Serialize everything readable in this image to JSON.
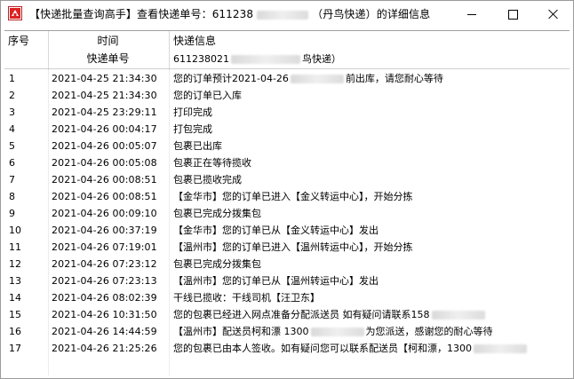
{
  "window": {
    "title_prefix": "【快递批量查询高手】查看快递单号：611238",
    "title_suffix": "（丹鸟快递）的详细信息"
  },
  "columns": {
    "no": "序号",
    "time": "时间",
    "info": "快递信息"
  },
  "subheader": {
    "time": "快递单号",
    "info_prefix": "611238021",
    "info_suffix": "鸟快递）"
  },
  "rows": [
    {
      "no": "1",
      "time": "2021-04-25 21:34:30",
      "info": "您的订单预计2021-04-26",
      "info_tail": "前出库，请您耐心等待"
    },
    {
      "no": "2",
      "time": "2021-04-25 21:34:30",
      "info": "您的订单已入库",
      "info_tail": ""
    },
    {
      "no": "3",
      "time": "2021-04-25 23:29:11",
      "info": "打印完成",
      "info_tail": ""
    },
    {
      "no": "4",
      "time": "2021-04-26 00:04:17",
      "info": "打包完成",
      "info_tail": ""
    },
    {
      "no": "5",
      "time": "2021-04-26 00:05:07",
      "info": "包裹已出库",
      "info_tail": ""
    },
    {
      "no": "6",
      "time": "2021-04-26 00:05:08",
      "info": "包裹正在等待揽收",
      "info_tail": ""
    },
    {
      "no": "7",
      "time": "2021-04-26 00:08:51",
      "info": "包裹已揽收完成",
      "info_tail": ""
    },
    {
      "no": "8",
      "time": "2021-04-26 00:08:51",
      "info": "【金华市】您的订单已进入【金义转运中心】，开始分拣",
      "info_tail": ""
    },
    {
      "no": "9",
      "time": "2021-04-26 00:09:10",
      "info": "包裹已完成分拨集包",
      "info_tail": ""
    },
    {
      "no": "10",
      "time": "2021-04-26 00:37:19",
      "info": "【金华市】您的订单已从【金义转运中心】发出",
      "info_tail": ""
    },
    {
      "no": "11",
      "time": "2021-04-26 07:19:01",
      "info": "【温州市】您的订单已进入【温州转运中心】，开始分拣",
      "info_tail": ""
    },
    {
      "no": "12",
      "time": "2021-04-26 07:23:12",
      "info": "包裹已完成分拨集包",
      "info_tail": ""
    },
    {
      "no": "13",
      "time": "2021-04-26 07:23:13",
      "info": "【温州市】您的订单已从【温州转运中心】发出",
      "info_tail": ""
    },
    {
      "no": "14",
      "time": "2021-04-26 08:02:39",
      "info": "干线已揽收：干线司机【汪卫东】",
      "info_tail": ""
    },
    {
      "no": "15",
      "time": "2021-04-26 10:31:50",
      "info": "您的包裹已经进入网点准备分配派送员 如有疑问请联系158",
      "info_tail": ""
    },
    {
      "no": "16",
      "time": "2021-04-26 14:44:59",
      "info": "【温州市】配送员柯和漂 1300",
      "info_tail": "为您派送，感谢您的耐心等待"
    },
    {
      "no": "17",
      "time": "2021-04-26 21:25:26",
      "info": "您的包裹已由本人签收。如有疑问您可以联系配送员【柯和漂，1300",
      "info_tail": ""
    }
  ]
}
